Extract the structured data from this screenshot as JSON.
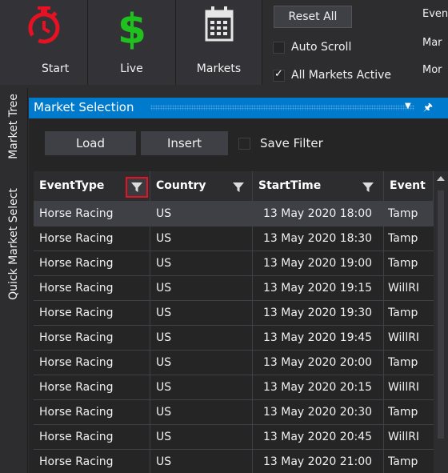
{
  "toolbar": {
    "start_label": "Start",
    "live_label": "Live",
    "markets_label": "Markets",
    "reset_all_label": "Reset All",
    "auto_scroll_label": "Auto Scroll",
    "auto_scroll_checked": false,
    "all_markets_active_label": "All Markets Active",
    "all_markets_active_checked": true,
    "side_labels": [
      "Even",
      "Mar",
      "Mor"
    ]
  },
  "side_tabs": [
    "Market Tree",
    "Quick Market Select"
  ],
  "panel": {
    "title": "Market Selection",
    "load_label": "Load",
    "insert_label": "Insert",
    "save_filter_label": "Save Filter",
    "save_filter_checked": false
  },
  "grid": {
    "columns": [
      "EventType",
      "Country",
      "StartTime",
      "Event"
    ],
    "rows": [
      [
        "Horse Racing",
        "US",
        "13 May 2020 18:00",
        "Tamp"
      ],
      [
        "Horse Racing",
        "US",
        "13 May 2020 18:30",
        "Tamp"
      ],
      [
        "Horse Racing",
        "US",
        "13 May 2020 19:00",
        "Tamp"
      ],
      [
        "Horse Racing",
        "US",
        "13 May 2020 19:15",
        "WillRI"
      ],
      [
        "Horse Racing",
        "US",
        "13 May 2020 19:30",
        "Tamp"
      ],
      [
        "Horse Racing",
        "US",
        "13 May 2020 19:45",
        "WillRI"
      ],
      [
        "Horse Racing",
        "US",
        "13 May 2020 20:00",
        "Tamp"
      ],
      [
        "Horse Racing",
        "US",
        "13 May 2020 20:15",
        "WillRI"
      ],
      [
        "Horse Racing",
        "US",
        "13 May 2020 20:30",
        "Tamp"
      ],
      [
        "Horse Racing",
        "US",
        "13 May 2020 20:45",
        "WillRI"
      ],
      [
        "Horse Racing",
        "US",
        "13 May 2020 21:00",
        "Tamp"
      ]
    ],
    "selected_row": 0
  },
  "colors": {
    "accent": "#007acc",
    "start_icon": "#e81123",
    "live_icon": "#1fc11f",
    "filter_highlight": "#e81123"
  }
}
